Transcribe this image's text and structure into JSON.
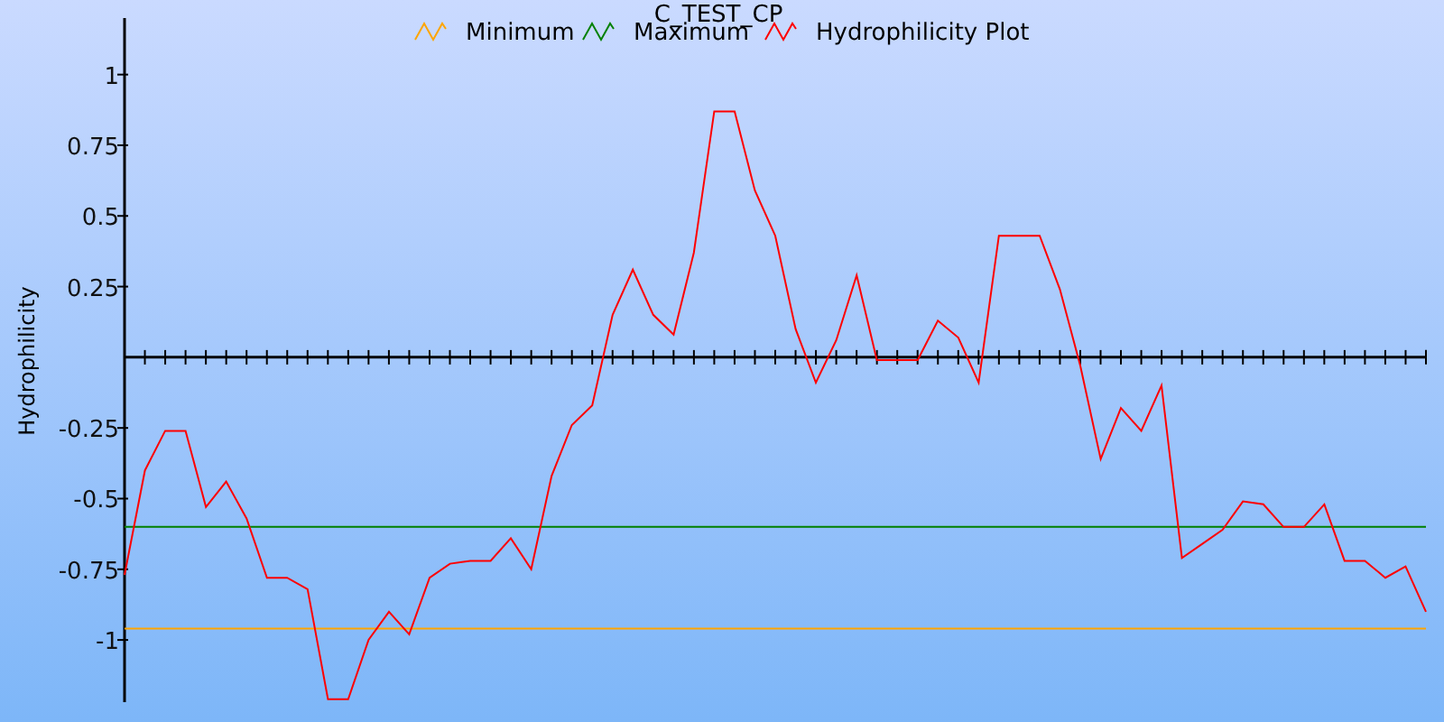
{
  "chart_data": {
    "type": "line",
    "title": "C_TEST_CP",
    "ylabel": "Hydrophilicity",
    "legend": "top",
    "ylim": [
      -1.22,
      1.2
    ],
    "yticks": [
      -1,
      -0.75,
      -0.5,
      -0.25,
      0.25,
      0.5,
      0.75,
      1
    ],
    "series": [
      {
        "name": "Minimum",
        "color": "#ffa500",
        "values": [
          -0.96,
          -0.96,
          -0.96,
          -0.96,
          -0.96,
          -0.96,
          -0.96,
          -0.96,
          -0.96,
          -0.96,
          -0.96,
          -0.96,
          -0.96,
          -0.96,
          -0.96,
          -0.96,
          -0.96,
          -0.96,
          -0.96,
          -0.96,
          -0.96,
          -0.96,
          -0.96,
          -0.96,
          -0.96,
          -0.96,
          -0.96,
          -0.96,
          -0.96,
          -0.96,
          -0.96,
          -0.96,
          -0.96,
          -0.96,
          -0.96,
          -0.96,
          -0.96,
          -0.96,
          -0.96,
          -0.96,
          -0.96,
          -0.96,
          -0.96,
          -0.96,
          -0.96,
          -0.96,
          -0.96,
          -0.96,
          -0.96,
          -0.96,
          -0.96,
          -0.96,
          -0.96,
          -0.96,
          -0.96,
          -0.96,
          -0.96,
          -0.96,
          -0.96,
          -0.96,
          -0.96,
          -0.96,
          -0.96,
          -0.96,
          -0.96
        ]
      },
      {
        "name": "Maximum",
        "color": "#008000",
        "values": [
          -0.6,
          -0.6,
          -0.6,
          -0.6,
          -0.6,
          -0.6,
          -0.6,
          -0.6,
          -0.6,
          -0.6,
          -0.6,
          -0.6,
          -0.6,
          -0.6,
          -0.6,
          -0.6,
          -0.6,
          -0.6,
          -0.6,
          -0.6,
          -0.6,
          -0.6,
          -0.6,
          -0.6,
          -0.6,
          -0.6,
          -0.6,
          -0.6,
          -0.6,
          -0.6,
          -0.6,
          -0.6,
          -0.6,
          -0.6,
          -0.6,
          -0.6,
          -0.6,
          -0.6,
          -0.6,
          -0.6,
          -0.6,
          -0.6,
          -0.6,
          -0.6,
          -0.6,
          -0.6,
          -0.6,
          -0.6,
          -0.6,
          -0.6,
          -0.6,
          -0.6,
          -0.6,
          -0.6,
          -0.6,
          -0.6,
          -0.6,
          -0.6,
          -0.6,
          -0.6,
          -0.6,
          -0.6,
          -0.6,
          -0.6,
          -0.6
        ]
      },
      {
        "name": "Hydrophilicity Plot",
        "color": "#ff0000",
        "values": [
          -0.77,
          -0.4,
          -0.26,
          -0.26,
          -0.53,
          -0.44,
          -0.57,
          -0.78,
          -0.78,
          -0.82,
          -1.21,
          -1.21,
          -1.0,
          -0.9,
          -0.98,
          -0.78,
          -0.73,
          -0.72,
          -0.72,
          -0.64,
          -0.75,
          -0.42,
          -0.24,
          -0.17,
          0.15,
          0.31,
          0.15,
          0.08,
          0.37,
          0.87,
          0.87,
          0.59,
          0.43,
          0.1,
          -0.09,
          0.06,
          0.29,
          -0.01,
          -0.01,
          -0.01,
          0.13,
          0.07,
          -0.09,
          0.43,
          0.43,
          0.43,
          0.24,
          -0.03,
          -0.36,
          -0.18,
          -0.26,
          -0.1,
          -0.71,
          -0.66,
          -0.61,
          -0.51,
          -0.52,
          -0.6,
          -0.6,
          -0.52,
          -0.72,
          -0.72,
          -0.78,
          -0.74,
          -0.9
        ]
      }
    ]
  }
}
